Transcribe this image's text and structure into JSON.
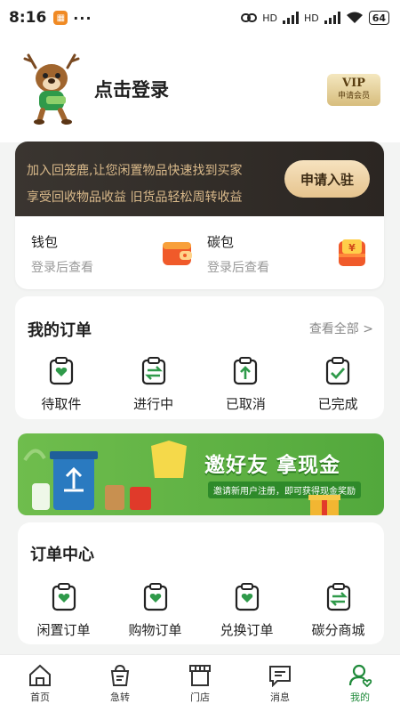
{
  "status_bar": {
    "time": "8:16",
    "battery": "64",
    "network_1": "HD",
    "network_2": "HD"
  },
  "header": {
    "login_text": "点击登录",
    "vip_title": "VIP",
    "vip_sub": "申请会员"
  },
  "join": {
    "line1": "加入回笼鹿,让您闲置物品快速找到买家",
    "line2": "享受回收物品收益 旧货品轻松周转收益",
    "apply_label": "申请入驻"
  },
  "wallet": {
    "label": "钱包",
    "hint": "登录后查看"
  },
  "carbon": {
    "label": "碳包",
    "hint": "登录后查看"
  },
  "my_orders": {
    "title": "我的订单",
    "view_all": "查看全部 >",
    "items": [
      {
        "label": "待取件",
        "icon": "clipboard-heart-icon"
      },
      {
        "label": "进行中",
        "icon": "clipboard-transfer-icon"
      },
      {
        "label": "已取消",
        "icon": "clipboard-up-icon"
      },
      {
        "label": "已完成",
        "icon": "clipboard-check-icon"
      }
    ]
  },
  "promo": {
    "headline": "邀好友 拿现金",
    "subline": "邀请新用户注册，即可获得现金奖励"
  },
  "order_center": {
    "title": "订单中心",
    "items": [
      {
        "label": "闲置订单",
        "icon": "clipboard-heart-icon"
      },
      {
        "label": "购物订单",
        "icon": "clipboard-heart-icon"
      },
      {
        "label": "兑换订单",
        "icon": "clipboard-heart-icon"
      },
      {
        "label": "碳分商城",
        "icon": "clipboard-transfer-icon"
      }
    ]
  },
  "tabbar": {
    "items": [
      {
        "label": "首页",
        "icon": "home-icon"
      },
      {
        "label": "急转",
        "icon": "bag-icon"
      },
      {
        "label": "门店",
        "icon": "store-icon"
      },
      {
        "label": "消息",
        "icon": "message-icon"
      },
      {
        "label": "我的",
        "icon": "profile-icon"
      }
    ],
    "active": "我的"
  },
  "colors": {
    "brand_green": "#1f8a3a",
    "gold": "#d9b98a",
    "dark_banner": "#2b2622"
  }
}
